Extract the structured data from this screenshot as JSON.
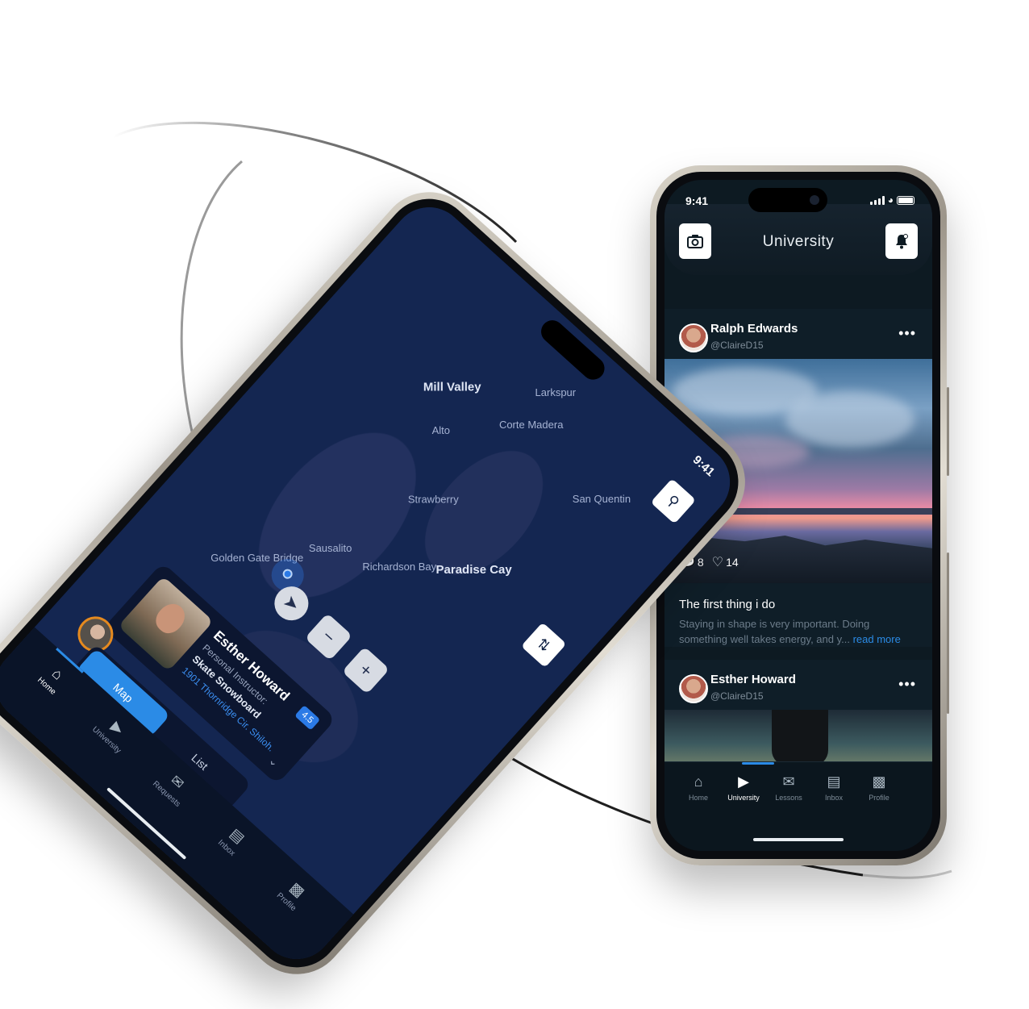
{
  "right_phone": {
    "status": {
      "time": "9:41"
    },
    "header": {
      "title": "University",
      "left_icon": "camera-icon",
      "right_icon": "bell-icon"
    },
    "posts": [
      {
        "name": "Ralph Edwards",
        "handle": "@ClaireD15",
        "more": "•••",
        "comments": "8",
        "likes": "14",
        "title": "The first thing i do",
        "text": "Staying in shape is very important. Doing something well takes energy, and y...",
        "read_more": "read more"
      },
      {
        "name": "Esther Howard",
        "handle": "@ClaireD15",
        "more": "•••"
      }
    ],
    "nav": [
      {
        "label": "Home",
        "icon": "home-icon"
      },
      {
        "label": "University",
        "icon": "play-icon"
      },
      {
        "label": "Lessons",
        "icon": "lessons-icon"
      },
      {
        "label": "Inbox",
        "icon": "chat-icon"
      },
      {
        "label": "Profile",
        "icon": "profile-card-icon"
      }
    ],
    "active_tab": "University"
  },
  "left_phone": {
    "status": {
      "time": "9:41"
    },
    "map_labels": {
      "mill_valley": "Mill Valley",
      "larkspur": "Larkspur",
      "corte_madera": "Corte Madera",
      "alto": "Alto",
      "strawberry": "Strawberry",
      "paradise_cay": "Paradise Cay",
      "san_quentin": "San Quentin",
      "richardson_bay": "Richardson Bay",
      "sausalito": "Sausalito",
      "golden_gate_bridge": "Golden Gate Bridge"
    },
    "card": {
      "name": "Esther Howard",
      "role": "Personal Instructor:",
      "skills": "Skate Snowboard",
      "address": "1901 Thornridge Cir. Shiloh...",
      "rating": "4.5"
    },
    "toggle": {
      "map": "Map",
      "list": "List"
    },
    "nav": [
      {
        "label": "Home",
        "icon": "home-icon"
      },
      {
        "label": "University",
        "icon": "play-icon"
      },
      {
        "label": "Requests",
        "icon": "requests-icon"
      },
      {
        "label": "Inbox",
        "icon": "chat-icon"
      },
      {
        "label": "Profile",
        "icon": "profile-card-icon"
      }
    ],
    "active_tab": "Home"
  },
  "colors": {
    "accent": "#2b8be6",
    "feed_bg": "#0d1a22",
    "map_bg": "#142651"
  }
}
